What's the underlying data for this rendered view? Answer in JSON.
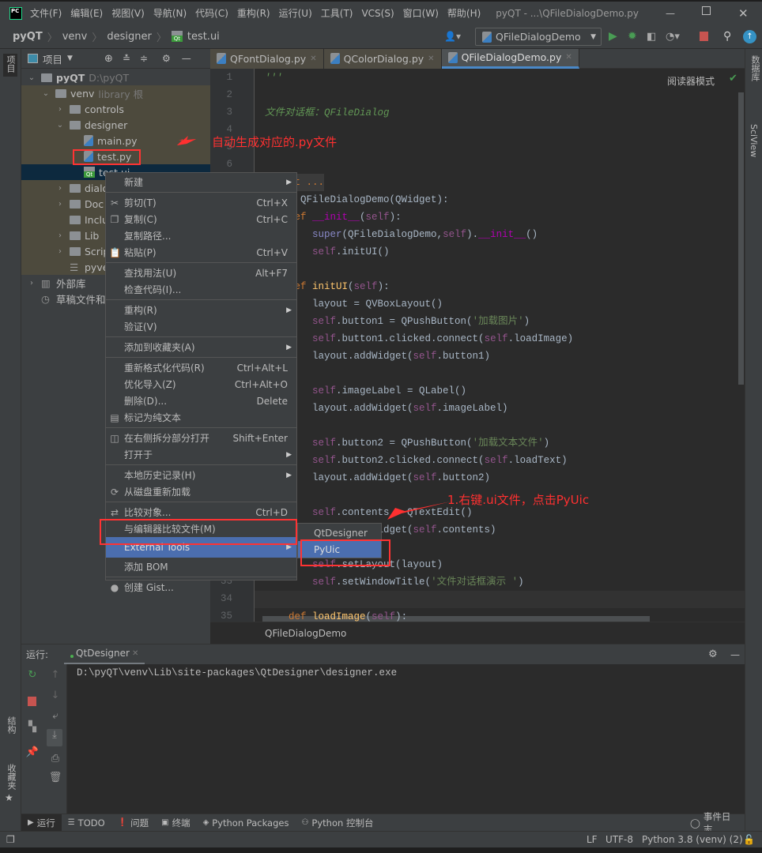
{
  "window": {
    "title": "pyQT - ...\\QFileDialogDemo.py",
    "menu": [
      "文件(F)",
      "编辑(E)",
      "视图(V)",
      "导航(N)",
      "代码(C)",
      "重构(R)",
      "运行(U)",
      "工具(T)",
      "VCS(S)",
      "窗口(W)",
      "帮助(H)"
    ]
  },
  "breadcrumb": [
    "pyQT",
    "venv",
    "designer",
    "test.ui"
  ],
  "run_config": "QFileDialogDemo",
  "project_panel": {
    "title": "项目"
  },
  "editor_tabs": [
    {
      "label": "QFontDialog.py"
    },
    {
      "label": "QColorDialog.py"
    },
    {
      "label": "QFileDialogDemo.py",
      "active": true
    }
  ],
  "tree": [
    {
      "label": "pyQT",
      "hint": "D:\\pyQT",
      "type": "folder",
      "fold": "v",
      "depth": 0
    },
    {
      "label": "venv",
      "hint": "library 根",
      "type": "folder",
      "fold": "v",
      "depth": 1,
      "lib": true
    },
    {
      "label": "controls",
      "type": "folder",
      "fold": ">",
      "depth": 2,
      "lib": true
    },
    {
      "label": "designer",
      "type": "folder",
      "fold": "v",
      "depth": 2,
      "lib": true
    },
    {
      "label": "main.py",
      "type": "py",
      "depth": 3,
      "lib": true
    },
    {
      "label": "test.py",
      "type": "py",
      "depth": 3,
      "lib": true
    },
    {
      "label": "test.ui",
      "type": "ui",
      "depth": 3,
      "selected": true
    },
    {
      "label": "dialo",
      "type": "folder",
      "fold": ">",
      "depth": 2,
      "lib": true
    },
    {
      "label": "Doc",
      "type": "folder",
      "fold": ">",
      "depth": 2,
      "lib": true
    },
    {
      "label": "Inclu",
      "type": "folder",
      "depth": 2,
      "lib": true
    },
    {
      "label": "Lib",
      "type": "folder",
      "fold": ">",
      "depth": 2,
      "lib": true
    },
    {
      "label": "Scrip",
      "type": "folder",
      "fold": ">",
      "depth": 2,
      "lib": true
    },
    {
      "label": "pyve",
      "type": "cfg",
      "depth": 2,
      "lib": true
    },
    {
      "label": "外部库",
      "type": "lib",
      "fold": ">",
      "depth": 0
    },
    {
      "label": "草稿文件和控制台",
      "type": "scratch",
      "depth": 0
    }
  ],
  "editor": {
    "reader_mode": "阅读器模式",
    "breadcrumb": "QFileDialogDemo",
    "line_numbers": [
      {
        "n": "1",
        "line": 0
      },
      {
        "n": "2",
        "line": 1
      },
      {
        "n": "3",
        "line": 2
      },
      {
        "n": "4",
        "line": 3
      },
      {
        "n": "5",
        "line": 4
      },
      {
        "n": "6",
        "line": 5
      },
      {
        "n": "33",
        "line": 29
      },
      {
        "n": "34",
        "line": 30
      },
      {
        "n": "35",
        "line": 31
      }
    ],
    "lines": [
      [
        [
          "'''",
          "cm"
        ]
      ],
      [],
      [
        [
          "文件对话框：QFileDialog",
          "cm"
        ]
      ],
      [],
      [],
      [],
      [
        [
          "import ...",
          "kw"
        ]
      ],
      [
        [
          "class ",
          "kw"
        ],
        [
          "QFileDialogDemo(QWidget):",
          ""
        ]
      ],
      [
        [
          "    def ",
          "kw"
        ],
        [
          "__init__",
          "mg"
        ],
        [
          "(",
          ""
        ],
        [
          "self",
          "sf"
        ],
        [
          "):",
          ""
        ]
      ],
      [
        [
          "        ",
          ""
        ],
        [
          "super",
          "bi"
        ],
        [
          "(QFileDialogDemo,",
          ""
        ],
        [
          "self",
          "sf"
        ],
        [
          ").",
          ""
        ],
        [
          "__init__",
          "mg"
        ],
        [
          "()",
          ""
        ]
      ],
      [
        [
          "        ",
          ""
        ],
        [
          "self",
          "sf"
        ],
        [
          ".initUI()",
          ""
        ]
      ],
      [],
      [
        [
          "    def ",
          "kw"
        ],
        [
          "initUI",
          "fn"
        ],
        [
          "(",
          ""
        ],
        [
          "self",
          "sf"
        ],
        [
          "):",
          ""
        ]
      ],
      [
        [
          "        layout = QVBoxLayout()",
          ""
        ]
      ],
      [
        [
          "        ",
          ""
        ],
        [
          "self",
          "sf"
        ],
        [
          ".button1 = QPushButton(",
          ""
        ],
        [
          "'加载图片'",
          "st"
        ],
        [
          ")",
          ""
        ]
      ],
      [
        [
          "        ",
          ""
        ],
        [
          "self",
          "sf"
        ],
        [
          ".button1.clicked.connect(",
          ""
        ],
        [
          "self",
          "sf"
        ],
        [
          ".loadImage)",
          ""
        ]
      ],
      [
        [
          "        layout.addWidget(",
          ""
        ],
        [
          "self",
          "sf"
        ],
        [
          ".button1)",
          ""
        ]
      ],
      [],
      [
        [
          "        ",
          ""
        ],
        [
          "self",
          "sf"
        ],
        [
          ".imageLabel = QLabel()",
          ""
        ]
      ],
      [
        [
          "        layout.addWidget(",
          ""
        ],
        [
          "self",
          "sf"
        ],
        [
          ".imageLabel)",
          ""
        ]
      ],
      [],
      [
        [
          "        ",
          ""
        ],
        [
          "self",
          "sf"
        ],
        [
          ".button2 = QPushButton(",
          ""
        ],
        [
          "'加载文本文件'",
          "st"
        ],
        [
          ")",
          ""
        ]
      ],
      [
        [
          "        ",
          ""
        ],
        [
          "self",
          "sf"
        ],
        [
          ".button2.clicked.connect(",
          ""
        ],
        [
          "self",
          "sf"
        ],
        [
          ".loadText)",
          ""
        ]
      ],
      [
        [
          "        layout.addWidget(",
          ""
        ],
        [
          "self",
          "sf"
        ],
        [
          ".button2)",
          ""
        ]
      ],
      [],
      [
        [
          "        ",
          ""
        ],
        [
          "self",
          "sf"
        ],
        [
          ".contents = QTextEdit()",
          ""
        ]
      ],
      [
        [
          "        layout.addWidget(",
          ""
        ],
        [
          "self",
          "sf"
        ],
        [
          ".contents)",
          ""
        ]
      ],
      [],
      [
        [
          "        ",
          ""
        ],
        [
          "self",
          "sf"
        ],
        [
          ".setLayout(layout)",
          ""
        ]
      ],
      [
        [
          "        ",
          ""
        ],
        [
          "self",
          "sf"
        ],
        [
          ".setWindowTitle(",
          ""
        ],
        [
          "'文件对话框演示 '",
          "st"
        ],
        [
          ")",
          ""
        ]
      ],
      [],
      [
        [
          "    def ",
          "kw"
        ],
        [
          "loadImage",
          "fn"
        ],
        [
          "(",
          ""
        ],
        [
          "self",
          "sf"
        ],
        [
          "):",
          ""
        ]
      ]
    ]
  },
  "context_menu": [
    {
      "label": "新建",
      "arrow": true
    },
    {
      "sep": true
    },
    {
      "label": "剪切(T)",
      "shortcut": "Ctrl+X",
      "icon": "✂"
    },
    {
      "label": "复制(C)",
      "shortcut": "Ctrl+C",
      "icon": "❐"
    },
    {
      "label": "复制路径..."
    },
    {
      "label": "粘贴(P)",
      "shortcut": "Ctrl+V",
      "icon": "📋"
    },
    {
      "sep": true
    },
    {
      "label": "查找用法(U)",
      "shortcut": "Alt+F7"
    },
    {
      "label": "检查代码(I)..."
    },
    {
      "sep": true
    },
    {
      "label": "重构(R)",
      "arrow": true
    },
    {
      "label": "验证(V)"
    },
    {
      "sep": true
    },
    {
      "label": "添加到收藏夹(A)",
      "arrow": true
    },
    {
      "sep": true
    },
    {
      "label": "重新格式化代码(R)",
      "shortcut": "Ctrl+Alt+L"
    },
    {
      "label": "优化导入(Z)",
      "shortcut": "Ctrl+Alt+O"
    },
    {
      "label": "删除(D)...",
      "shortcut": "Delete"
    },
    {
      "label": "标记为纯文本",
      "icon": "▤"
    },
    {
      "sep": true
    },
    {
      "label": "在右侧拆分部分打开",
      "shortcut": "Shift+Enter",
      "icon": "◫"
    },
    {
      "label": "打开于",
      "arrow": true
    },
    {
      "sep": true
    },
    {
      "label": "本地历史记录(H)",
      "arrow": true
    },
    {
      "label": "从磁盘重新加载",
      "icon": "⟳"
    },
    {
      "sep": true
    },
    {
      "label": "比较对象...",
      "shortcut": "Ctrl+D",
      "icon": "⇄"
    },
    {
      "label": "与编辑器比较文件(M)"
    },
    {
      "label": "External Tools",
      "arrow": true,
      "highlighted": true
    },
    {
      "label": "添加 BOM"
    },
    {
      "sep": true
    },
    {
      "label": "创建 Gist...",
      "icon": "●"
    }
  ],
  "submenu": [
    {
      "label": "QtDesigner"
    },
    {
      "label": "PyUic",
      "highlighted": true
    }
  ],
  "annotations": {
    "generated": "自动生成对应的.py文件",
    "step1": "1.右键.ui文件，点击PyUic"
  },
  "run_panel": {
    "label": "运行:",
    "tab": "QtDesigner",
    "output": "D:\\pyQT\\venv\\Lib\\site-packages\\QtDesigner\\designer.exe"
  },
  "left_strip": {
    "project": "项目",
    "structure": "结构",
    "favorites": "收藏夹"
  },
  "right_strip": {
    "database": "数据库",
    "sciview": "SciView"
  },
  "bottom_tools": [
    {
      "label": "运行",
      "icon": "play-icon"
    },
    {
      "label": "TODO",
      "icon": "list-icon"
    },
    {
      "label": "问题",
      "icon": "warning-icon"
    },
    {
      "label": "终端",
      "icon": "terminal-icon"
    },
    {
      "label": "Python Packages",
      "icon": "layers-icon"
    },
    {
      "label": "Python 控制台",
      "icon": "python-icon"
    }
  ],
  "event_log": "事件日志",
  "status": {
    "line_sep": "LF",
    "encoding": "UTF-8",
    "interpreter": "Python 3.8 (venv) (2)"
  },
  "colors": {
    "accent": "#4b6eaf",
    "annotation": "#ff3030",
    "run_green": "#499c54",
    "stop_red": "#c75450"
  }
}
